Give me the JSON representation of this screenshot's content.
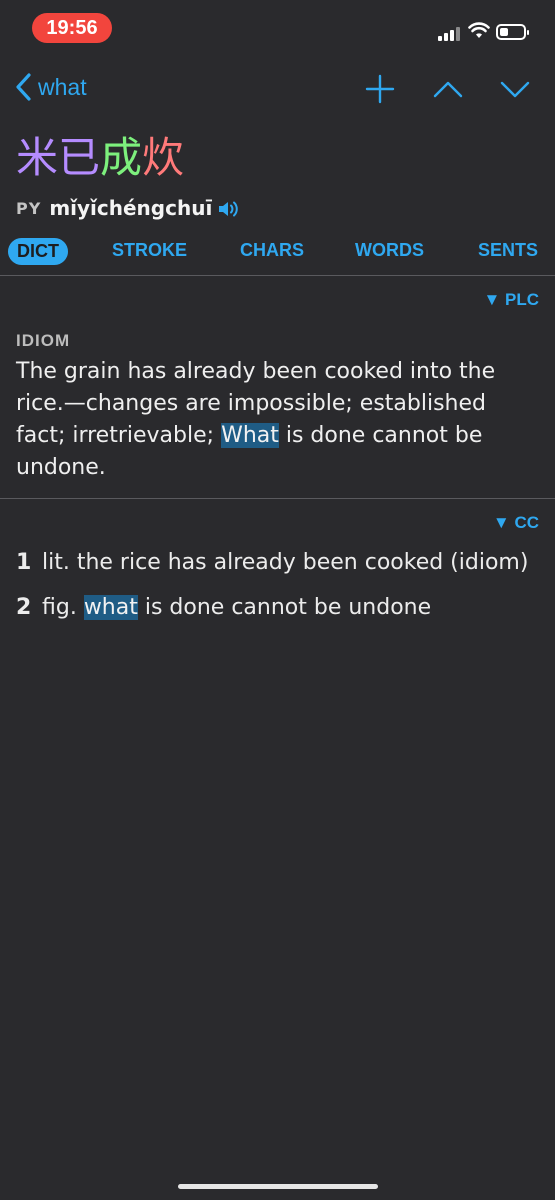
{
  "status": {
    "time": "19:56"
  },
  "nav": {
    "back_label": "what",
    "add_icon": "plus-icon",
    "prev_icon": "chevron-up-icon",
    "next_icon": "chevron-down-icon"
  },
  "headword": {
    "chars": [
      {
        "text": "米",
        "color": "#b58cff"
      },
      {
        "text": "已",
        "color": "#b58cff"
      },
      {
        "text": "成",
        "color": "#7df07d"
      },
      {
        "text": "炊",
        "color": "#ff7a7a"
      }
    ],
    "py_label": "PY",
    "pinyin": "mǐyǐchéngchuī"
  },
  "tabs": [
    "DICT",
    "STROKE",
    "CHARS",
    "WORDS",
    "SENTS"
  ],
  "sections": {
    "plc": {
      "source": "▼ PLC",
      "label": "IDIOM",
      "def_part1": "The grain has already been cooked into the rice.—changes are impossible; established fact; irretrievable; ",
      "def_highlight": "What",
      "def_part2": " is done cannot be undone."
    },
    "cc": {
      "source": "▼ CC",
      "senses": [
        {
          "num": "1",
          "text_pre": "lit. the rice has already been cooked (idiom)",
          "highlight": "",
          "text_post": ""
        },
        {
          "num": "2",
          "text_pre": "fig. ",
          "highlight": "what",
          "text_post": " is done cannot be undone"
        }
      ]
    }
  },
  "colors": {
    "accent": "#2fa8f0",
    "background": "#2a2a2d",
    "highlight": "#1f5c85"
  }
}
